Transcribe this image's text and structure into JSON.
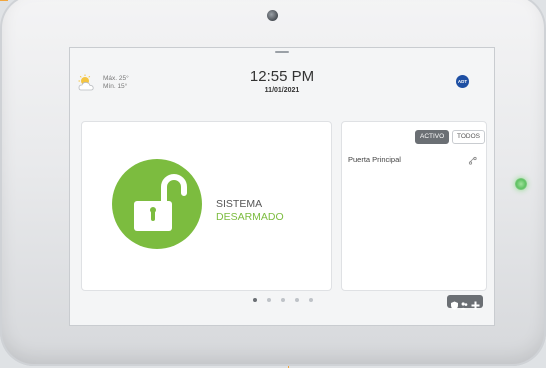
{
  "weather": {
    "high": "Máx. 25°",
    "low": "Mín. 15°",
    "icon": "partly-cloudy-icon"
  },
  "header": {
    "time": "12:55 PM",
    "date": "11/01/2021",
    "brand": "ADT"
  },
  "system": {
    "title": "SISTEMA",
    "state": "DESARMADO",
    "icon": "unlocked-padlock-icon",
    "state_color": "#7cbc3f"
  },
  "sensors": {
    "tabs": [
      {
        "label": "ACTIVO",
        "selected": true
      },
      {
        "label": "TODOS",
        "selected": false
      }
    ],
    "items": [
      {
        "name": "Puerta Principal",
        "icon": "door-sensor-icon"
      }
    ]
  },
  "pagination": {
    "pages": 5,
    "current": 1
  },
  "quick_actions": [
    "shield-icon",
    "people-icon",
    "plus-icon"
  ],
  "colors": {
    "callout": "#f0a640",
    "accent_green": "#7cbc3f",
    "brand_blue": "#1e4fa3"
  }
}
